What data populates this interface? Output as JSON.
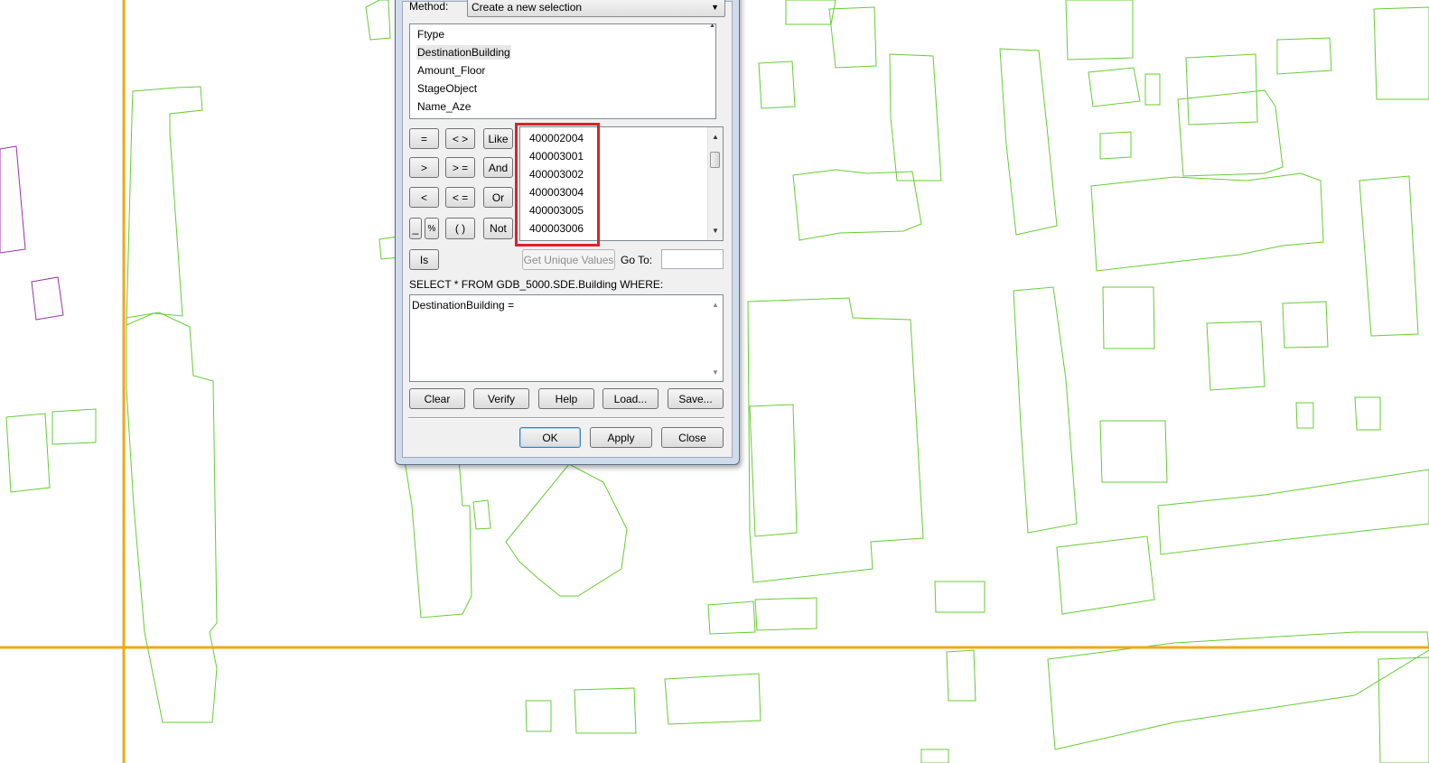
{
  "method": {
    "label": "Method:",
    "value": "Create a new selection"
  },
  "fields": {
    "items": [
      "Ftype",
      "DestinationBuilding",
      "Amount_Floor",
      "StageObject",
      "Name_Aze"
    ],
    "selected_index": 1
  },
  "operators": {
    "eq": "=",
    "ne": "< >",
    "like": "Like",
    "gt": ">",
    "ge": "> =",
    "and": "And",
    "lt": "<",
    "le": "< =",
    "or": "Or",
    "underscore": "_",
    "percent": "%",
    "parens": "( )",
    "not": "Not",
    "is": "Is"
  },
  "values": {
    "items": [
      "400002004",
      "400003001",
      "400003002",
      "400003004",
      "400003005",
      "400003006"
    ]
  },
  "get_unique_values": "Get Unique Values",
  "goto": {
    "label": "Go To:",
    "value": ""
  },
  "sql_prefix": "SELECT * FROM GDB_5000.SDE.Building WHERE:",
  "expression": "DestinationBuilding =",
  "actions": {
    "clear": "Clear",
    "verify": "Verify",
    "help": "Help",
    "load": "Load...",
    "save": "Save..."
  },
  "footer": {
    "ok": "OK",
    "apply": "Apply",
    "close": "Close"
  },
  "colors": {
    "building": "#66cc33",
    "grid": "#f0a818",
    "other": "#9933aa",
    "highlight": "#e0202a"
  }
}
